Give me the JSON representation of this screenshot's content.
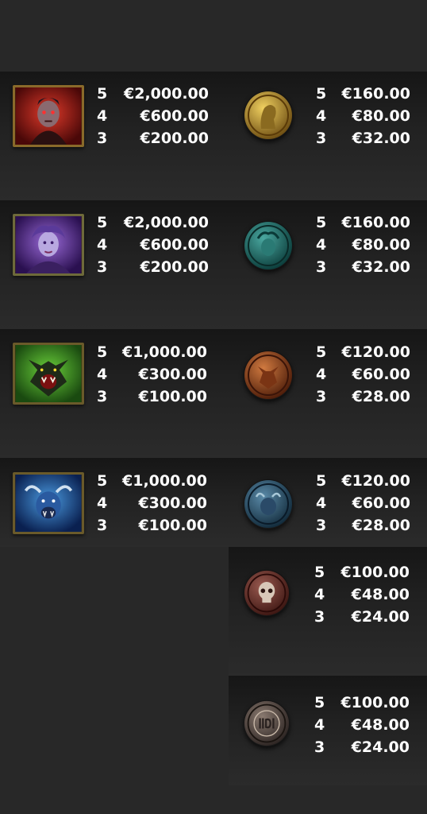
{
  "left_symbols": [
    {
      "name": "Hades",
      "payouts": [
        {
          "count": "5",
          "amount": "€2,000.00"
        },
        {
          "count": "4",
          "amount": "€600.00"
        },
        {
          "count": "3",
          "amount": "€200.00"
        }
      ]
    },
    {
      "name": "Medusa",
      "payouts": [
        {
          "count": "5",
          "amount": "€2,000.00"
        },
        {
          "count": "4",
          "amount": "€600.00"
        },
        {
          "count": "3",
          "amount": "€200.00"
        }
      ]
    },
    {
      "name": "Cerberus",
      "payouts": [
        {
          "count": "5",
          "amount": "€1,000.00"
        },
        {
          "count": "4",
          "amount": "€300.00"
        },
        {
          "count": "3",
          "amount": "€100.00"
        }
      ]
    },
    {
      "name": "Minotaur",
      "payouts": [
        {
          "count": "5",
          "amount": "€1,000.00"
        },
        {
          "count": "4",
          "amount": "€300.00"
        },
        {
          "count": "3",
          "amount": "€100.00"
        }
      ]
    }
  ],
  "right_symbols": [
    {
      "name": "Gold bust coin",
      "payouts": [
        {
          "count": "5",
          "amount": "€160.00"
        },
        {
          "count": "4",
          "amount": "€80.00"
        },
        {
          "count": "3",
          "amount": "€32.00"
        }
      ]
    },
    {
      "name": "Teal medusa coin",
      "payouts": [
        {
          "count": "5",
          "amount": "€160.00"
        },
        {
          "count": "4",
          "amount": "€80.00"
        },
        {
          "count": "3",
          "amount": "€32.00"
        }
      ]
    },
    {
      "name": "Copper wolf coin",
      "payouts": [
        {
          "count": "5",
          "amount": "€120.00"
        },
        {
          "count": "4",
          "amount": "€60.00"
        },
        {
          "count": "3",
          "amount": "€28.00"
        }
      ]
    },
    {
      "name": "Blue beast coin",
      "payouts": [
        {
          "count": "5",
          "amount": "€120.00"
        },
        {
          "count": "4",
          "amount": "€60.00"
        },
        {
          "count": "3",
          "amount": "€28.00"
        }
      ]
    },
    {
      "name": "Skull coin",
      "payouts": [
        {
          "count": "5",
          "amount": "€100.00"
        },
        {
          "count": "4",
          "amount": "€48.00"
        },
        {
          "count": "3",
          "amount": "€24.00"
        }
      ]
    },
    {
      "name": "Greek coin",
      "payouts": [
        {
          "count": "5",
          "amount": "€100.00"
        },
        {
          "count": "4",
          "amount": "€48.00"
        },
        {
          "count": "3",
          "amount": "€24.00"
        }
      ]
    }
  ],
  "colors": {
    "background": "#282828",
    "text": "#ffffff",
    "frame_gold": "#8a6a2a"
  }
}
